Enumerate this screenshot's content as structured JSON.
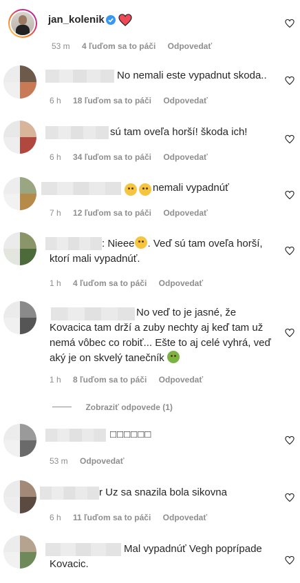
{
  "caption": {
    "username": "jan_kolenik",
    "time": "53 m",
    "likes": "4 ľuďom sa to páči",
    "reply": "Odpovedať"
  },
  "comments": [
    {
      "text": "No nemali este vypadnut skoda..",
      "time": "6 h",
      "likes": "18 ľuďom sa to páči",
      "reply": "Odpovedať"
    },
    {
      "text": "sú tam oveľa horší! škoda ich!",
      "time": "6 h",
      "likes": "34 ľuďom sa to páči",
      "reply": "Odpovedať"
    },
    {
      "text": "nemali vypadnúť",
      "time": "7 h",
      "likes": "12 ľuďom sa to páči",
      "reply": "Odpovedať"
    },
    {
      "text_before_emoji": ": Nieee",
      "text_after_emoji": ". Veď sú tam oveľa horší,",
      "text_line2": "ktorí mali vypadnúť.",
      "time": "1 h",
      "likes": "4 ľuďom sa to páči",
      "reply": "Odpovedať"
    },
    {
      "text_line1": "No veď to je jasné, že",
      "text_line2": "Kovacica tam drží a zuby nechty aj keď tam už",
      "text_line3": "nemá vôbec co robiť... Ešte to aj celé vyhrá, veď",
      "text_line4": "aký je on skvelý tanečník",
      "time": "1 h",
      "likes": "8 ľuďom sa to páči",
      "reply": "Odpovedať",
      "view_replies": "Zobraziť odpovede (1)"
    },
    {
      "text": "□□□□□□",
      "time": "53 m",
      "reply": "Odpovedať"
    },
    {
      "text": "r Uz sa snazila bola sikovna",
      "time": "6 h",
      "likes": "11 ľuďom sa to páči",
      "reply": "Odpovedať"
    },
    {
      "text_line1": "Mal vypadnúť Vegh poprípade",
      "text_line2": "Kovacic."
    }
  ],
  "colors": {
    "verified": "#3897f0",
    "heart_red": "#ed4956",
    "meta_gray": "#8e8e8e",
    "text": "#262626"
  },
  "icons": [
    "verified-badge-icon",
    "red-heart-icon",
    "like-heart-icon"
  ]
}
